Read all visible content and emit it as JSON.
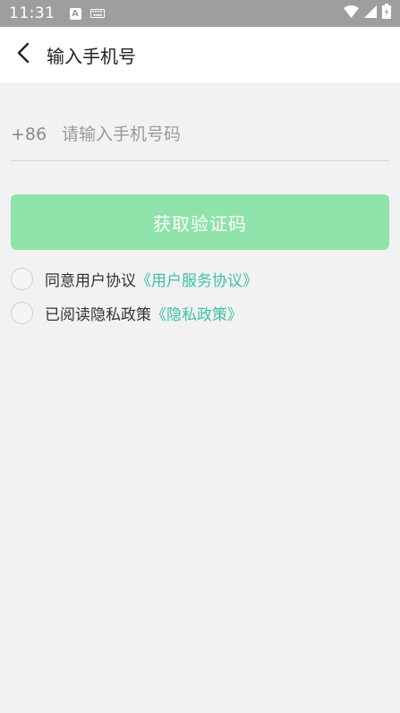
{
  "status_bar": {
    "time": "11:31",
    "a_label": "A",
    "icons": [
      "keyboard-icon",
      "wifi-icon",
      "signal-icon",
      "battery-icon"
    ]
  },
  "app_bar": {
    "title": "输入手机号",
    "back_icon": "chevron-left-icon"
  },
  "phone": {
    "country_code": "+86",
    "placeholder": "请输入手机号码",
    "value": ""
  },
  "verify_button": {
    "label": "获取验证码",
    "color": "#8fe3aa"
  },
  "agreements": [
    {
      "text": "同意用户协议",
      "link": "《用户服务协议》",
      "checked": false
    },
    {
      "text": "已阅读隐私政策",
      "link": "《隐私政策》",
      "checked": false
    }
  ],
  "colors": {
    "status_bar": "#9e9e9e",
    "link": "#3fc1a5",
    "background": "#f2f2f2"
  }
}
